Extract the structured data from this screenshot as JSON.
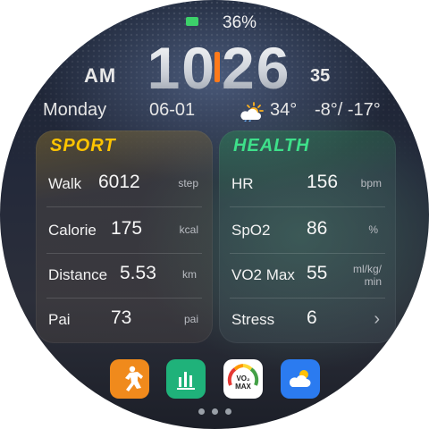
{
  "status": {
    "battery": "36%",
    "battery_color": "#3cd16a"
  },
  "clock": {
    "ampm": "AM",
    "hours": "10",
    "minutes": "26",
    "seconds": "35",
    "separator_color": "#ff7a1a"
  },
  "info": {
    "day": "Monday",
    "date": "06-01",
    "weather_icon": "partly-cloudy-sun-icon",
    "temperature": "34°",
    "range": "-8°/ -17°"
  },
  "sport": {
    "title": "SPORT",
    "title_color": "#ffc400",
    "rows": [
      {
        "label": "Walk",
        "value": "6012",
        "unit": "step"
      },
      {
        "label": "Calorie",
        "value": "175",
        "unit": "kcal"
      },
      {
        "label": "Distance",
        "value": "5.53",
        "unit": "km"
      },
      {
        "label": "Pai",
        "value": "73",
        "unit": "pai"
      }
    ]
  },
  "health": {
    "title": "HEALTH",
    "title_color": "#3ee08a",
    "rows": [
      {
        "label": "HR",
        "value": "156",
        "unit": "bpm"
      },
      {
        "label": "SpO2",
        "value": "86",
        "unit": "%"
      },
      {
        "label": "VO2 Max",
        "value": "55",
        "unit_line1": "ml/kg/",
        "unit_line2": "min"
      },
      {
        "label": "Stress",
        "value": "6",
        "chevron": "chevron-right-icon"
      }
    ]
  },
  "apps": [
    {
      "name": "workout-app-icon",
      "color": "#f08a1c"
    },
    {
      "name": "activity-chart-app-icon",
      "color": "#1fb27a"
    },
    {
      "name": "vo2-max-app-icon",
      "label_top": "VO₂",
      "label_bottom": "MAX"
    },
    {
      "name": "weather-app-icon",
      "color": "#2b7bf0"
    }
  ],
  "pager": {
    "pages": 3
  }
}
